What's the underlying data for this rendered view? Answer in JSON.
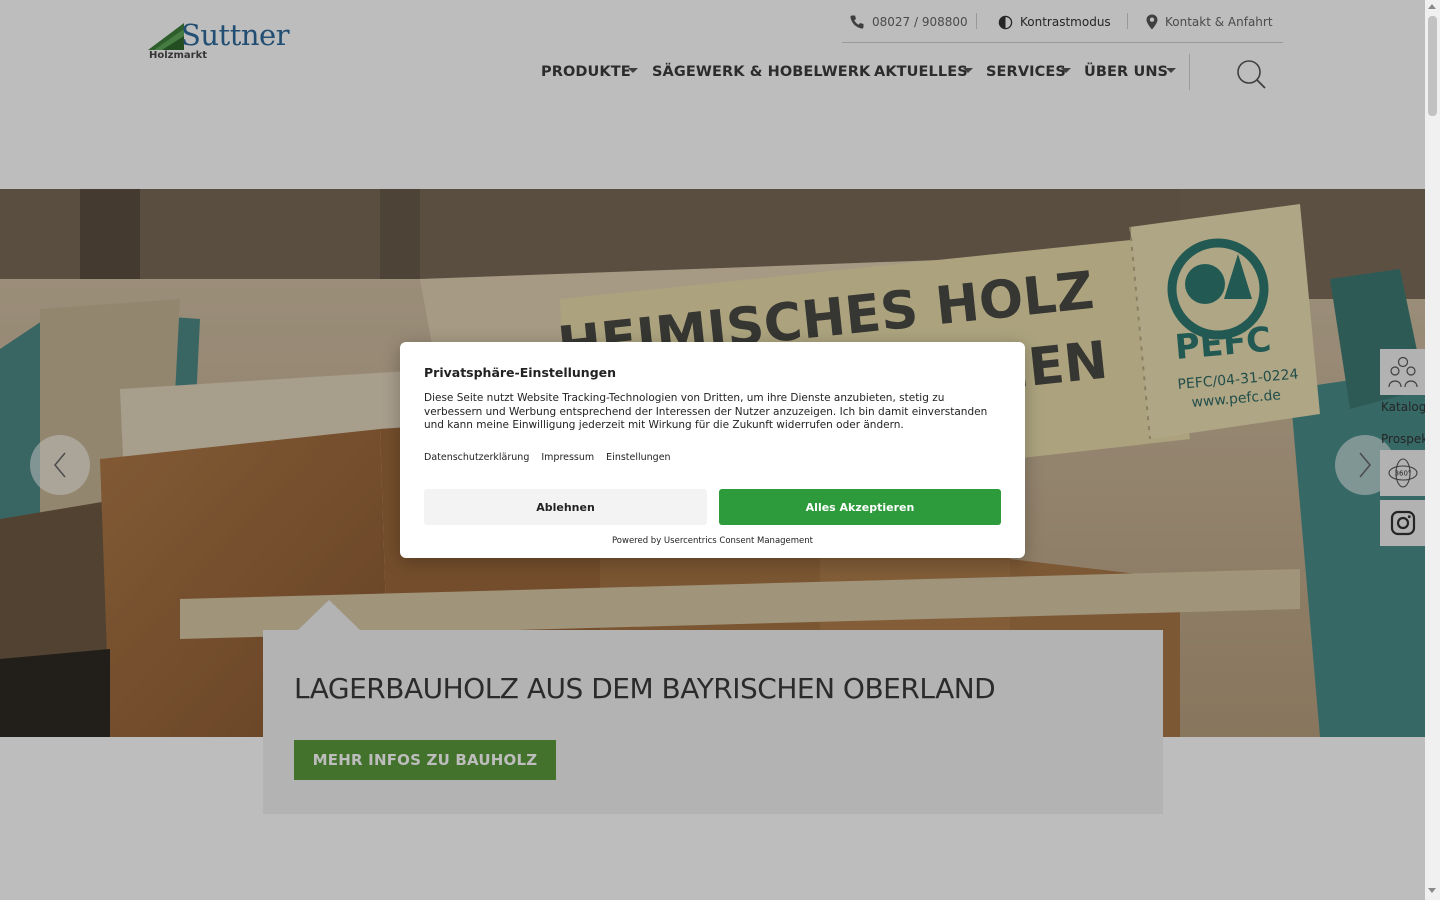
{
  "header": {
    "logo": {
      "word": "Suttner",
      "sub": "Holzmarkt"
    },
    "topbar": {
      "phone": "08027 / 908800",
      "contrast": "Kontrastmodus",
      "contact": "Kontakt & Anfahrt"
    },
    "nav": {
      "products": "PRODUKTE",
      "sawmill": "SÄGEWERK & HOBELWERK",
      "news": "AKTUELLES",
      "services": "SERVICES",
      "about": "ÜBER UNS"
    }
  },
  "hero": {
    "slide_title": "LAGERBAUHOLZ AUS DEM BAYRISCHEN OBERLAND",
    "cta_label": "MEHR INFOS ZU BAUHOLZ",
    "photo_text": {
      "line1": "HEIMISCHES HOLZ",
      "line2": "AUS BAYERISCHEN",
      "pefc": "PEFC",
      "pefc_id": "PEFC/04-31-0224",
      "pefc_url": "www.pefc.de"
    }
  },
  "side_links": {
    "catalog": "Kataloge",
    "brochure": "Prospekte",
    "tour_badge": "360°"
  },
  "consent": {
    "title": "Privatsphäre-Einstellungen",
    "body": "Diese Seite nutzt Website Tracking-Technologien von Dritten, um ihre Dienste anzubieten, stetig zu verbessern und Werbung entsprechend der Interessen der Nutzer anzuzeigen. Ich bin damit einverstanden und kann meine Einwilligung jederzeit mit Wirkung für die Zukunft widerrufen oder ändern.",
    "links": {
      "privacy": "Datenschutzerklärung",
      "imprint": "Impressum",
      "settings": "Einstellungen"
    },
    "decline": "Ablehnen",
    "accept": "Alles Akzeptieren",
    "powered": "Powered by Usercentrics Consent Management"
  },
  "colors": {
    "accent_green": "#5a9a3c",
    "accept_green": "#2d9a3c",
    "logo_blue": "#2d6a9a"
  }
}
